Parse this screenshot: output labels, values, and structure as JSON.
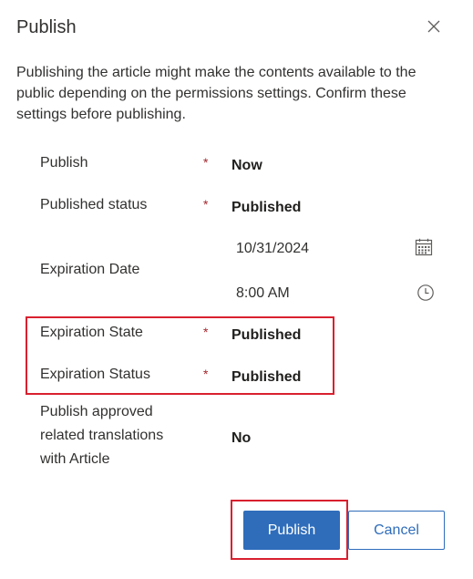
{
  "dialog": {
    "title": "Publish",
    "description": "Publishing the article might make the contents available to the public depending on the permissions settings. Confirm these settings before publishing."
  },
  "fields": {
    "publish": {
      "label": "Publish",
      "required_mark": "*",
      "value": "Now"
    },
    "published_status": {
      "label": "Published status",
      "required_mark": "*",
      "value": "Published"
    },
    "expiration_date": {
      "label": "Expiration Date",
      "date": "10/31/2024",
      "time": "8:00 AM"
    },
    "expiration_state": {
      "label": "Expiration State",
      "required_mark": "*",
      "value": "Published"
    },
    "expiration_status": {
      "label": "Expiration Status",
      "required_mark": "*",
      "value": "Published"
    },
    "related_translations": {
      "label_lines": [
        "Publish approved",
        "related translations",
        "with Article"
      ],
      "value": "No"
    }
  },
  "buttons": {
    "publish_label": "Publish",
    "cancel_label": "Cancel"
  },
  "colors": {
    "primary": "#2f6dbb",
    "required": "#a4262c",
    "highlight": "#d9202f"
  },
  "icons": [
    "close-icon",
    "calendar-icon",
    "clock-icon"
  ]
}
